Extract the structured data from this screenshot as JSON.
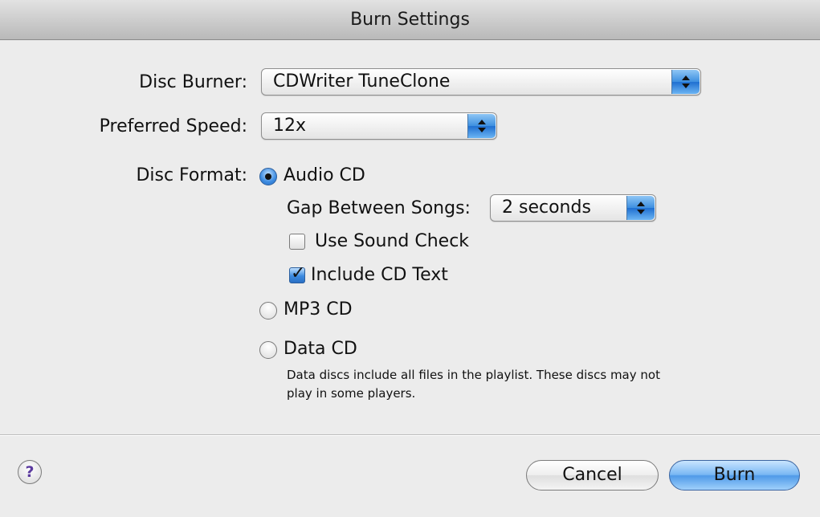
{
  "window": {
    "title": "Burn Settings"
  },
  "disc_burner": {
    "label": "Disc Burner:",
    "value": "CDWriter TuneClone"
  },
  "preferred_speed": {
    "label": "Preferred Speed:",
    "value": "12x"
  },
  "disc_format": {
    "label": "Disc Format:",
    "options": [
      {
        "label": "Audio CD",
        "selected": true
      },
      {
        "label": "MP3 CD",
        "selected": false
      },
      {
        "label": "Data CD",
        "selected": false
      }
    ],
    "gap": {
      "label": "Gap Between Songs:",
      "value": "2 seconds"
    },
    "use_sound_check": {
      "label": "Use Sound Check",
      "checked": false
    },
    "include_cd_text": {
      "label": "Include CD Text",
      "checked": true
    },
    "data_cd_note": "Data discs include all files in the playlist.  These discs may not play in some players."
  },
  "footer": {
    "help": "?",
    "cancel": "Cancel",
    "burn": "Burn"
  },
  "colors": {
    "accent": "#3b8ae0",
    "background": "#ececec"
  }
}
